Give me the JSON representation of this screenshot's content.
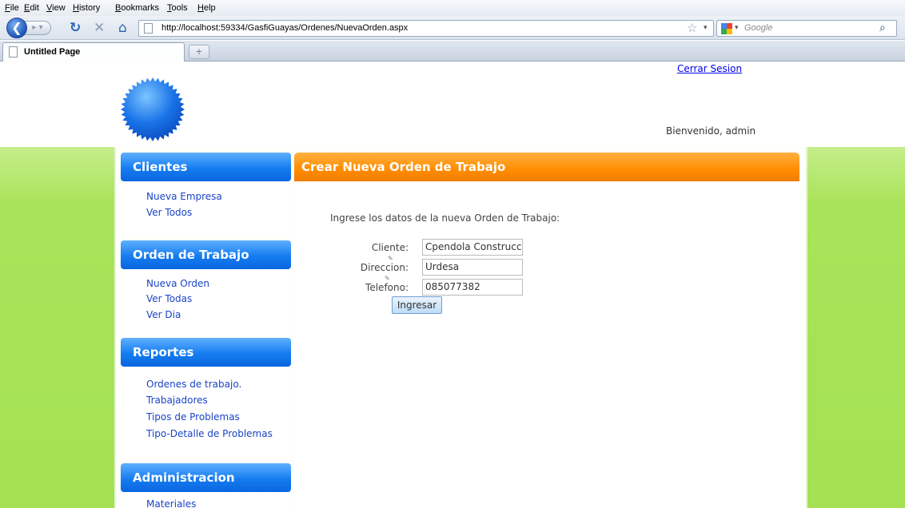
{
  "browser": {
    "menu": [
      "File",
      "Edit",
      "View",
      "History",
      "Bookmarks",
      "Tools",
      "Help"
    ],
    "url": "http://localhost:59334/GasfiGuayas/Ordenes/NuevaOrden.aspx",
    "search_placeholder": "Google",
    "tab_title": "Untitled Page",
    "new_tab_symbol": "+"
  },
  "header": {
    "logout": "Cerrar Sesion",
    "welcome": "Bienvenido, admin",
    "logo_color": "#1a73e8"
  },
  "sidebar": {
    "sections": [
      {
        "title": "Clientes",
        "links": [
          "Nueva Empresa",
          "Ver Todos"
        ]
      },
      {
        "title": "Orden de Trabajo",
        "links": [
          "Nueva Orden",
          "Ver Todas",
          "Ver Dia"
        ]
      },
      {
        "title": "Reportes",
        "links": [
          "Ordenes de trabajo.",
          "Trabajadores",
          "Tipos de Problemas",
          "Tipo-Detalle de Problemas"
        ]
      },
      {
        "title": "Administracion",
        "links": [
          "Materiales"
        ]
      }
    ]
  },
  "main": {
    "title": "Crear Nueva Orden de Trabajo",
    "intro": "Ingrese los datos de la nueva Orden de Trabajo:",
    "fields": [
      {
        "label": "Cliente:",
        "value": "Cpendola Construccion"
      },
      {
        "label": "Direccion:",
        "value": "Urdesa"
      },
      {
        "label": "Telefono:",
        "value": "085077382"
      }
    ],
    "submit": "Ingresar"
  },
  "colors": {
    "sidebar_header": "#157cf0",
    "main_header": "#ff8c00",
    "band": "#a9e35a",
    "link": "#1a44c7"
  }
}
